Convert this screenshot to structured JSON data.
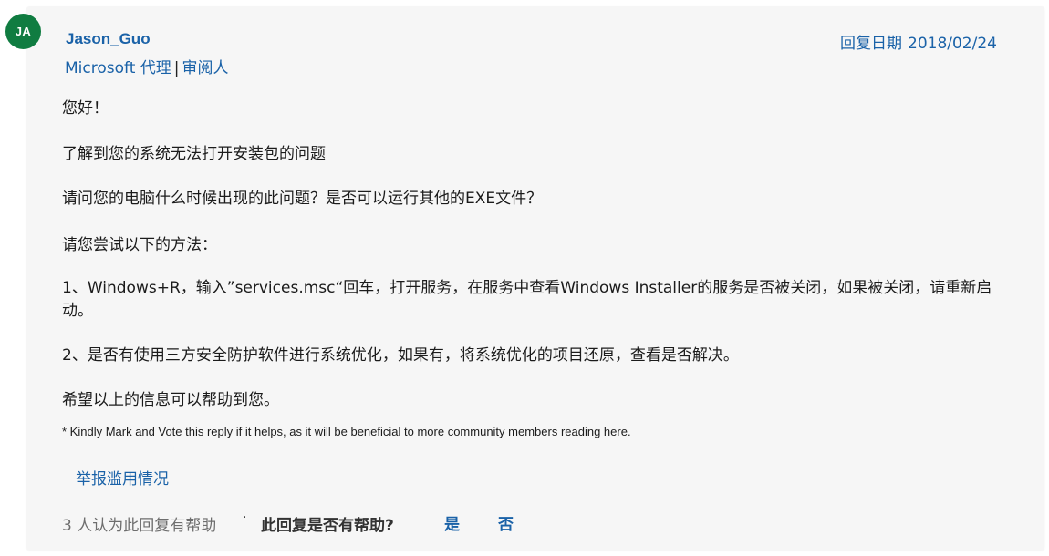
{
  "author": {
    "initials": "JA",
    "name": "Jason_Guo",
    "role": "Microsoft 代理",
    "separator": "|",
    "badge": "审阅人"
  },
  "reply_date": {
    "label": "回复日期",
    "value": "2018/02/24"
  },
  "body": {
    "greeting": "您好！",
    "line1": "了解到您的系统无法打开安装包的问题",
    "line2": "请问您的电脑什么时候出现的此问题？是否可以运行其他的EXE文件？",
    "line3": "请您尝试以下的方法：",
    "step1": "1、Windows+R，输入”services.msc“回车，打开服务，在服务中查看Windows Installer的服务是否被关闭，如果被关闭，请重新启动。",
    "step2": "2、是否有使用三方安全防护软件进行系统优化，如果有，将系统优化的项目还原，查看是否解决。",
    "closing": "希望以上的信息可以帮助到您。"
  },
  "footnote": "* Kindly Mark and Vote this reply if it helps, as it will be beneficial to more community members reading here.",
  "report_abuse": "举报滥用情况",
  "helpful": {
    "count_text": "3 人认为此回复有帮助",
    "dot": "·",
    "question": "此回复是否有帮助?",
    "yes": "是",
    "no": "否"
  },
  "colors": {
    "link": "#1a62a8",
    "avatar_bg": "#107c41",
    "card_bg": "#f6f6f6"
  }
}
